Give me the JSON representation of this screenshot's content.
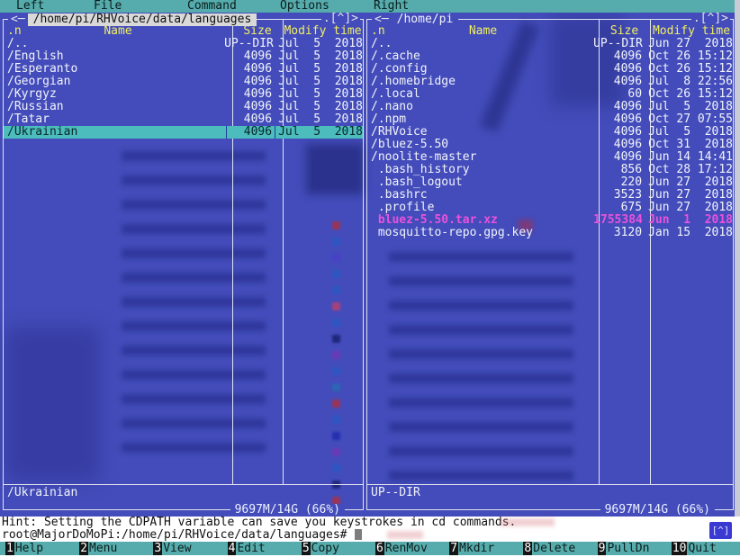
{
  "colors": {
    "menubar_teal": "#56acac",
    "panel_blue": "#434cba",
    "border_white": "#e2e3ee",
    "header_yellow": "#f2ef63",
    "selection_cyan": "#4cbcbc",
    "highlight_magenta": "#ea52dc",
    "text_white": "#f2f4fa",
    "active_path_bg": "#d9d9d9",
    "badge_blue": "#3a3ad2",
    "fkey_number_bg": "#141414"
  },
  "menubar": {
    "items": [
      {
        "label": "Left"
      },
      {
        "label": "File"
      },
      {
        "label": "Command"
      },
      {
        "label": "Options"
      },
      {
        "label": "Right"
      }
    ]
  },
  "panels": {
    "left": {
      "history_arrow": "<─",
      "path": "/home/pi/RHVoice/data/languages",
      "corner_controls": ".[^]>",
      "columns": {
        "sort": ".n",
        "name": "Name",
        "size": "Size",
        "mtime": "Modify time"
      },
      "rows": [
        {
          "name": "/..",
          "size": "UP--DIR",
          "mtime": "Jul  5  2018"
        },
        {
          "name": "/English",
          "size": "4096",
          "mtime": "Jul  5  2018"
        },
        {
          "name": "/Esperanto",
          "size": "4096",
          "mtime": "Jul  5  2018"
        },
        {
          "name": "/Georgian",
          "size": "4096",
          "mtime": "Jul  5  2018"
        },
        {
          "name": "/Kyrgyz",
          "size": "4096",
          "mtime": "Jul  5  2018"
        },
        {
          "name": "/Russian",
          "size": "4096",
          "mtime": "Jul  5  2018"
        },
        {
          "name": "/Tatar",
          "size": "4096",
          "mtime": "Jul  5  2018"
        },
        {
          "name": "/Ukrainian",
          "size": "4096",
          "mtime": "Jul  5  2018",
          "selected": true
        }
      ],
      "mini_status": "/Ukrainian",
      "free_space": "9697M/14G (66%)"
    },
    "right": {
      "history_arrow": "<─",
      "path": "/home/pi",
      "corner_controls": ".[^]>",
      "columns": {
        "sort": ".n",
        "name": "Name",
        "size": "Size",
        "mtime": "Modify time"
      },
      "rows": [
        {
          "name": "/..",
          "size": "UP--DIR",
          "mtime": "Jun 27  2018"
        },
        {
          "name": "/.cache",
          "size": "4096",
          "mtime": "Oct 26 15:12"
        },
        {
          "name": "/.config",
          "size": "4096",
          "mtime": "Oct 26 15:12"
        },
        {
          "name": "/.homebridge",
          "size": "4096",
          "mtime": "Jul  8 22:56"
        },
        {
          "name": "/.local",
          "size": "60",
          "mtime": "Oct 26 15:12"
        },
        {
          "name": "/.nano",
          "size": "4096",
          "mtime": "Jul  5  2018"
        },
        {
          "name": "/.npm",
          "size": "4096",
          "mtime": "Oct 27 07:55"
        },
        {
          "name": "/RHVoice",
          "size": "4096",
          "mtime": "Jul  5  2018"
        },
        {
          "name": "/bluez-5.50",
          "size": "4096",
          "mtime": "Oct 31  2018"
        },
        {
          "name": "/noolite-master",
          "size": "4096",
          "mtime": "Jun 14 14:41"
        },
        {
          "name": " .bash_history",
          "size": "856",
          "mtime": "Oct 28 17:12"
        },
        {
          "name": " .bash_logout",
          "size": "220",
          "mtime": "Jun 27  2018"
        },
        {
          "name": " .bashrc",
          "size": "3523",
          "mtime": "Jun 27  2018"
        },
        {
          "name": " .profile",
          "size": "675",
          "mtime": "Jun 27  2018"
        },
        {
          "name": " bluez-5.50.tar.xz",
          "size": "1755384",
          "mtime": "Jun  1  2018",
          "highlight": true
        },
        {
          "name": " mosquitto-repo.gpg.key",
          "size": "3120",
          "mtime": "Jan 15  2018"
        }
      ],
      "mini_status": "UP--DIR",
      "free_space": "9697M/14G (66%)"
    }
  },
  "hint": "Hint: Setting the CDPATH variable can save you keystrokes in cd commands.",
  "prompt": "root@MajorDoMoPi:/home/pi/RHVoice/data/languages#",
  "scroll_up_badge": "[^]",
  "function_keys": [
    {
      "num": "1",
      "label": "Help"
    },
    {
      "num": "2",
      "label": "Menu"
    },
    {
      "num": "3",
      "label": "View"
    },
    {
      "num": "4",
      "label": "Edit"
    },
    {
      "num": "5",
      "label": "Copy"
    },
    {
      "num": "6",
      "label": "RenMov"
    },
    {
      "num": "7",
      "label": "Mkdir"
    },
    {
      "num": "8",
      "label": "Delete"
    },
    {
      "num": "9",
      "label": "PullDn"
    },
    {
      "num": "10",
      "label": "Quit"
    }
  ]
}
